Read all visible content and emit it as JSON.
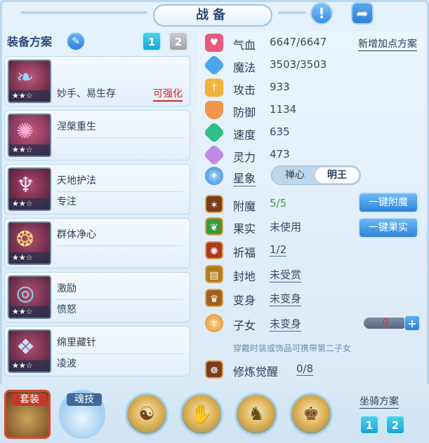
{
  "title": "战备",
  "left": {
    "header": "装备方案",
    "scheme_buttons": [
      "1",
      "2"
    ],
    "items": [
      {
        "name": "妙手、易生存",
        "sub": "",
        "stars": "★★☆",
        "strengthen": "可强化",
        "glyph": "❧"
      },
      {
        "name": "涅槃重生",
        "sub": "",
        "stars": "★★☆",
        "strengthen": "",
        "glyph": "✺"
      },
      {
        "name": "天地护法",
        "sub": "专注",
        "stars": "★★☆",
        "strengthen": "",
        "glyph": "♆"
      },
      {
        "name": "群体净心",
        "sub": "",
        "stars": "★★☆",
        "strengthen": "",
        "glyph": "❂"
      },
      {
        "name": "激励",
        "sub": "愤怒",
        "stars": "★★☆",
        "strengthen": "",
        "glyph": "◎"
      },
      {
        "name": "绵里藏针",
        "sub": "凌波",
        "stars": "★★☆",
        "strengthen": "",
        "glyph": "❖"
      }
    ]
  },
  "stats": {
    "hp": {
      "label": "气血",
      "value": "6647/6647"
    },
    "mp": {
      "label": "魔法",
      "value": "3503/3503"
    },
    "atk": {
      "label": "攻击",
      "value": "933"
    },
    "def": {
      "label": "防御",
      "value": "1134"
    },
    "spd": {
      "label": "速度",
      "value": "635"
    },
    "spi": {
      "label": "灵力",
      "value": "473"
    },
    "star": {
      "label": "星象",
      "opt1": "禅心",
      "opt2": "明王"
    },
    "new_scheme": "新增加点方案"
  },
  "extras": {
    "enchant": {
      "label": "附魔",
      "value": "5/5",
      "btn": "一键附魔"
    },
    "fruit": {
      "label": "果实",
      "value": "未使用",
      "btn": "一键果实"
    },
    "pray": {
      "label": "祈福",
      "value": "1/2"
    },
    "land": {
      "label": "封地",
      "value": "未受赏"
    },
    "transform": {
      "label": "变身",
      "value": "未变身"
    },
    "child": {
      "label": "子女",
      "value": "未变身",
      "count": "0"
    },
    "hint": "穿戴时装或饰品可携带第二子女",
    "cultivate": {
      "label": "修炼觉醒",
      "value": "0/8"
    }
  },
  "bottom": {
    "tab1": "套装",
    "tab2": "魂技",
    "mount_label": "坐骑方案",
    "mount_buttons": [
      "1",
      "2"
    ]
  },
  "colors": {
    "accent": "#2f7fd6",
    "teal": "#1ba4d6",
    "red": "#d42a2a",
    "green": "#3aa33a"
  }
}
